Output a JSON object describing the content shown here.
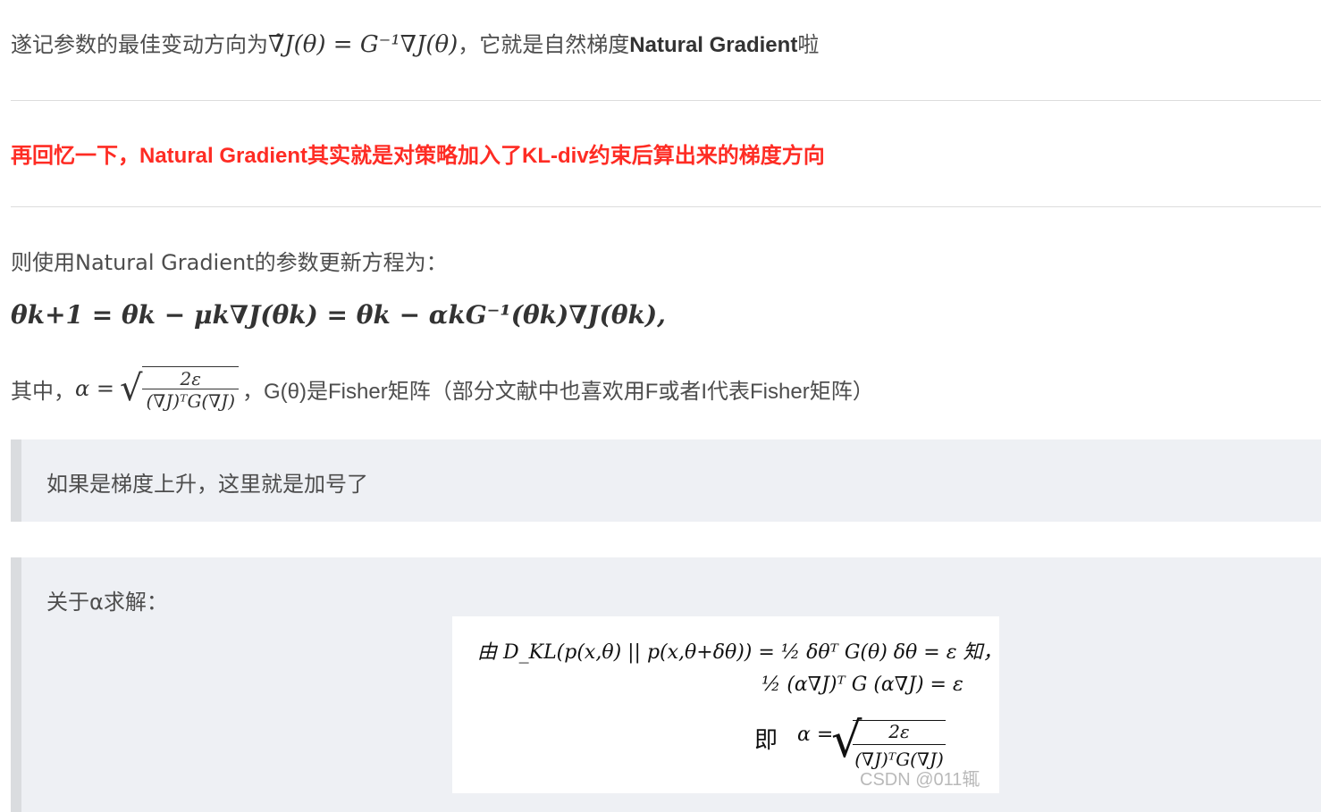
{
  "para1": {
    "prefix": "遂记参数的最佳变动方向为",
    "formula": "∇̃J(θ) = G⁻¹∇J(θ)",
    "mid": "，它就是自然梯度",
    "term": "Natural Gradient",
    "suffix": "啦"
  },
  "para2": {
    "text": "再回忆一下，Natural Gradient其实就是对策略加入了KL-div约束后算出来的梯度方向"
  },
  "para3": {
    "text": "则使用Natural Gradient的参数更新方程为："
  },
  "update_equation": {
    "text": "θk+1 = θk − μk∇J(θk) = θk − αkG⁻¹(θk)∇J(θk),"
  },
  "para4": {
    "prefix": "其中，",
    "alpha": "α =",
    "frac_num": "2ε",
    "frac_den": "(∇J)ᵀG(∇J)",
    "suffix": "，G(θ)是Fisher矩阵（部分文献中也喜欢用F或者I代表Fisher矩阵）"
  },
  "quote1": {
    "text": "如果是梯度上升，这里就是加号了"
  },
  "quote2": {
    "title": "关于α求解：",
    "image": {
      "line1": "由 D_KL(p(x,θ) || p(x,θ+δθ)) = ½ δθᵀ G(θ) δθ = ε 知，",
      "line2": "½ (α∇J)ᵀ G (α∇J) = ε",
      "line3_prefix": "即",
      "line3_alpha": "α =",
      "line3_num": "2ε",
      "line3_den": "(∇J)ᵀG(∇J)",
      "watermark": "CSDN @011辄"
    }
  }
}
